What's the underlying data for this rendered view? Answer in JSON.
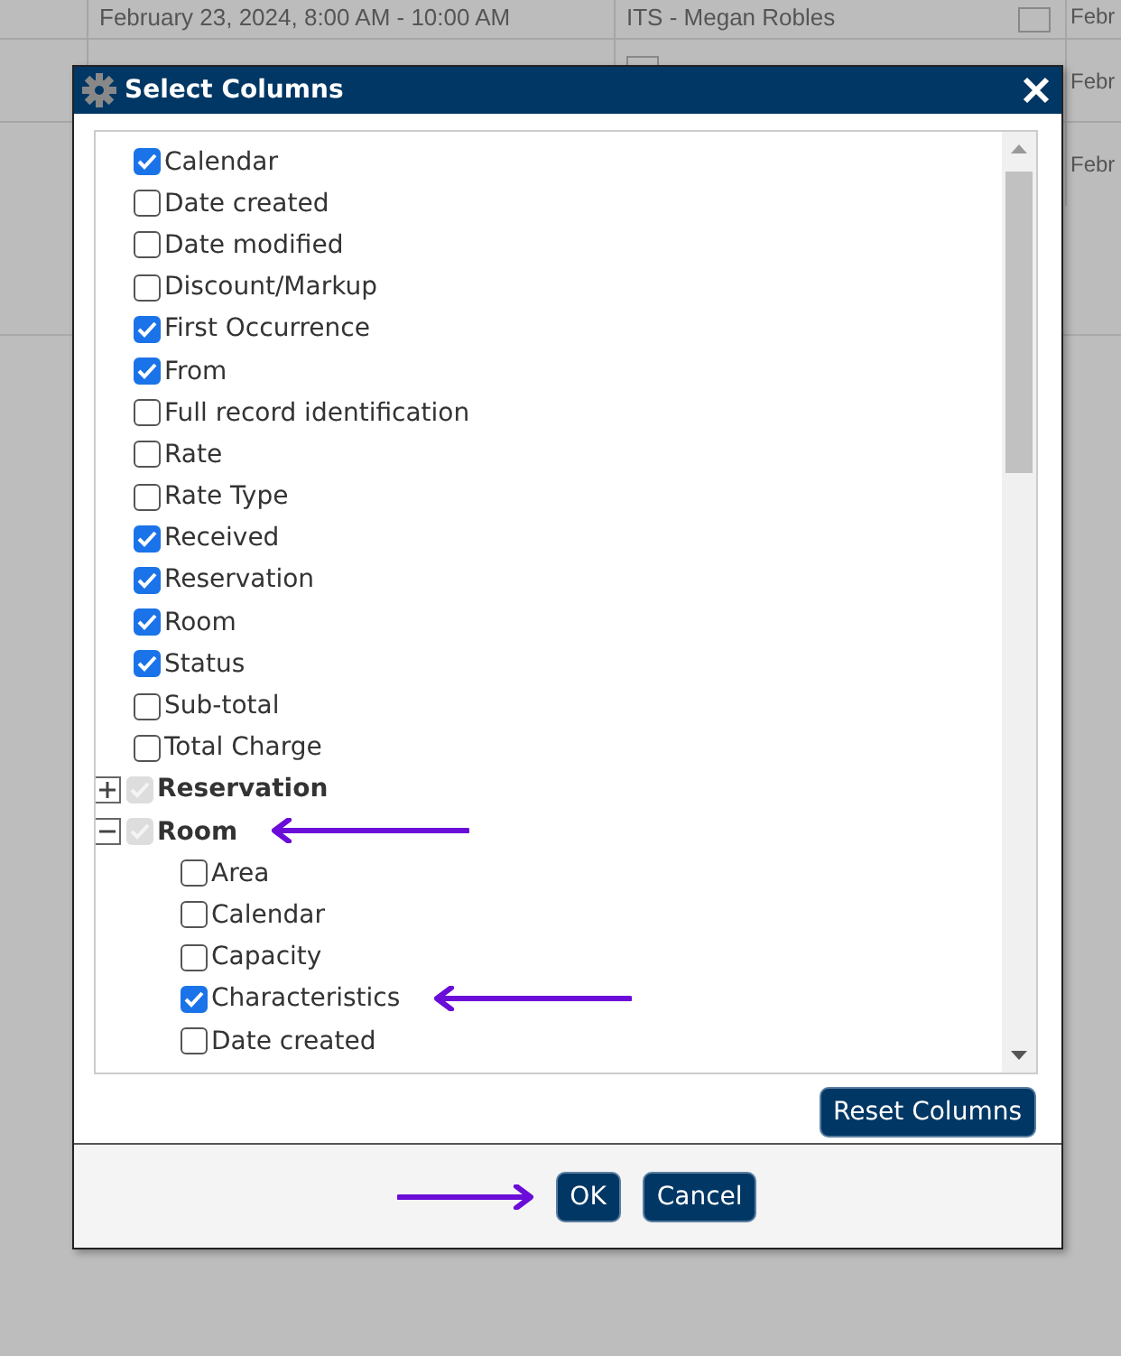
{
  "background_table": {
    "rows": [
      {
        "cells": [
          "February 23, 2024, 8:00 AM - 10:00 AM",
          "ITS - Megan Robles",
          "Febr"
        ]
      },
      {
        "cells": [
          "",
          "",
          "Febr"
        ]
      },
      {
        "cells": [
          "",
          "",
          "Febr"
        ]
      }
    ]
  },
  "dialog": {
    "title": "Select Columns",
    "columns": [
      {
        "kind": "column",
        "label": "Calendar",
        "checked": true
      },
      {
        "kind": "column",
        "label": "Date created",
        "checked": false
      },
      {
        "kind": "column",
        "label": "Date modified",
        "checked": false
      },
      {
        "kind": "column",
        "label": "Discount/Markup",
        "checked": false
      },
      {
        "kind": "column",
        "label": "First Occurrence",
        "checked": true
      },
      {
        "kind": "column",
        "label": "From",
        "checked": true
      },
      {
        "kind": "column",
        "label": "Full record identification",
        "checked": false
      },
      {
        "kind": "column",
        "label": "Rate",
        "checked": false
      },
      {
        "kind": "column",
        "label": "Rate Type",
        "checked": false
      },
      {
        "kind": "column",
        "label": "Received",
        "checked": true
      },
      {
        "kind": "column",
        "label": "Reservation",
        "checked": true
      },
      {
        "kind": "column",
        "label": "Room",
        "checked": true
      },
      {
        "kind": "column",
        "label": "Status",
        "checked": true
      },
      {
        "kind": "column",
        "label": "Sub-total",
        "checked": false
      },
      {
        "kind": "column",
        "label": "Total Charge",
        "checked": false
      },
      {
        "kind": "group",
        "label": "Reservation",
        "checked": true,
        "disabled": true,
        "expanded": false
      },
      {
        "kind": "group",
        "label": "Room",
        "checked": true,
        "disabled": true,
        "expanded": true,
        "annotated": true,
        "children": [
          {
            "kind": "column",
            "label": "Area",
            "checked": false
          },
          {
            "kind": "column",
            "label": "Calendar",
            "checked": false
          },
          {
            "kind": "column",
            "label": "Capacity",
            "checked": false
          },
          {
            "kind": "column",
            "label": "Characteristics",
            "checked": true,
            "annotated": true
          },
          {
            "kind": "column",
            "label": "Date created",
            "checked": false
          }
        ]
      }
    ],
    "reset_button": "Reset Columns",
    "buttons": [
      {
        "label": "OK",
        "annotated": true
      },
      {
        "label": "Cancel",
        "annotated": false
      }
    ]
  }
}
